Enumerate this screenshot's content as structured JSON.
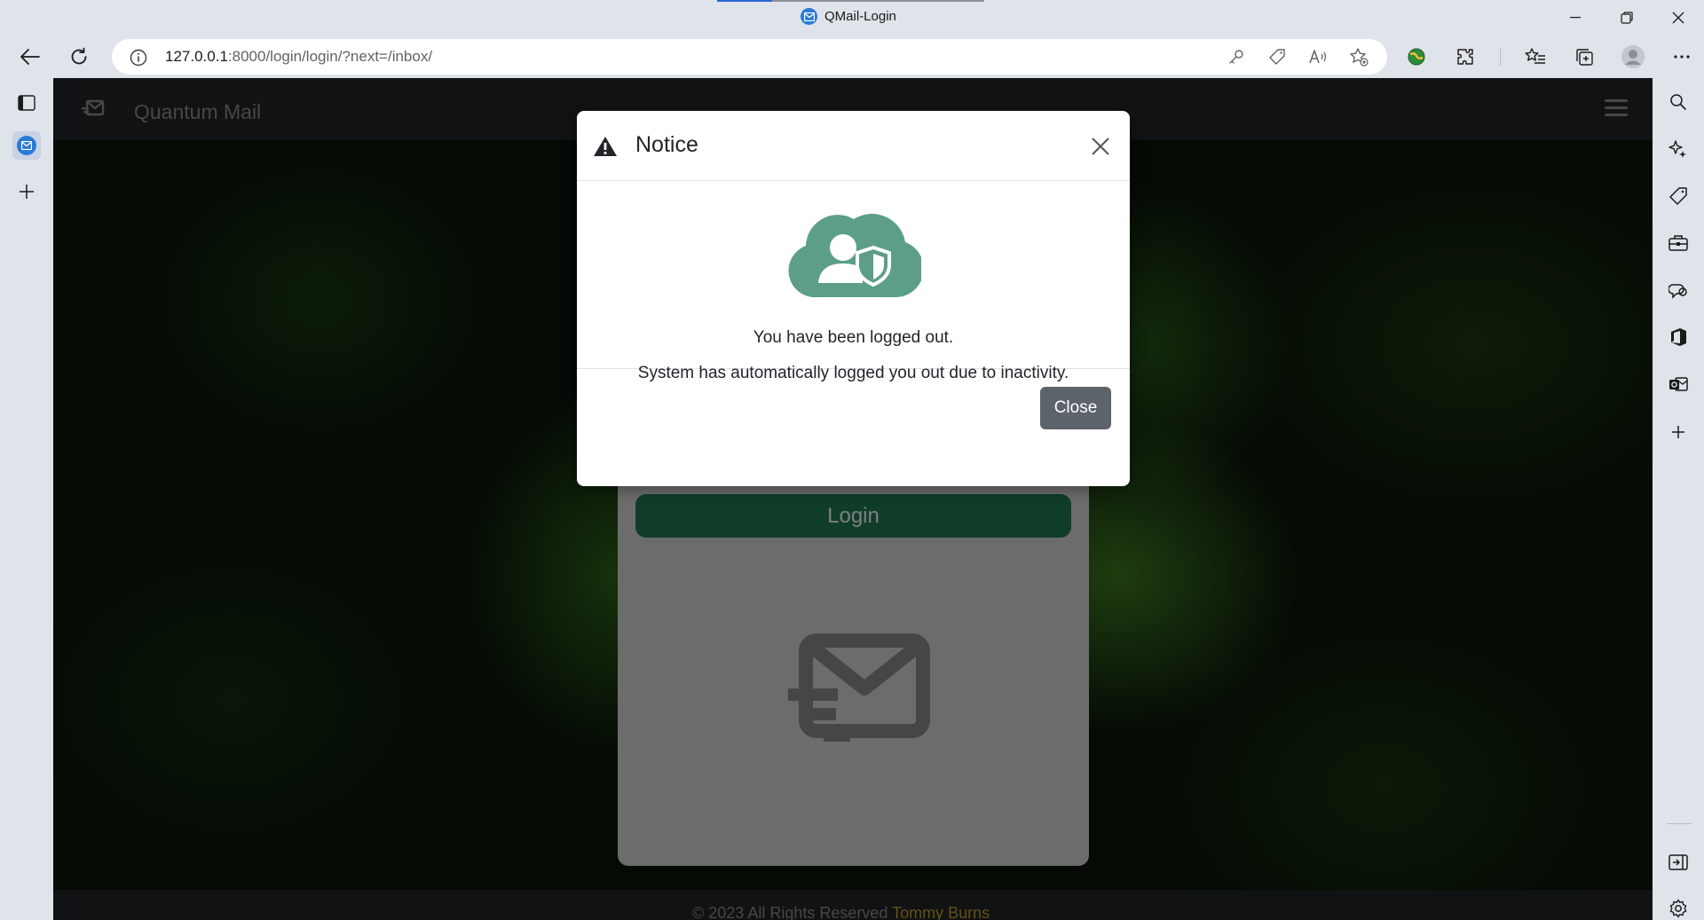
{
  "window": {
    "tab_title": "QMail-Login",
    "controls": {
      "minimize": "minimize",
      "restore": "restore",
      "close": "close"
    }
  },
  "browser": {
    "url_host": "127.0.0.1",
    "url_rest": ":8000/login/login/?next=/inbox/",
    "icons": [
      "back-icon",
      "refresh-icon",
      "info-icon",
      "key-icon",
      "tag-icon",
      "read-aloud-icon",
      "favorite-add-icon",
      "extension-globe-icon",
      "extensions-icon",
      "favorites-icon",
      "collections-icon",
      "profile-avatar",
      "more-icon"
    ]
  },
  "left_tabs": {
    "icons": [
      "tab-actions-icon",
      "qmail-tab-icon",
      "new-tab-icon"
    ]
  },
  "right_sidebar": {
    "icons": [
      "search-icon",
      "copilot-icon",
      "shopping-icon",
      "tools-icon",
      "games-icon",
      "office-icon",
      "outlook-icon",
      "add-icon",
      "hide-sidebar-icon",
      "settings-icon"
    ]
  },
  "app": {
    "brand": "Quantum Mail",
    "login_button": "Login",
    "footer_prefix": "© 2023 All Rights Reserved ",
    "footer_author": "Tommy Burns",
    "colors": {
      "navbar": "#212529",
      "login_button": "#1f7a50",
      "author": "#c9a227"
    }
  },
  "modal": {
    "title": "Notice",
    "message_primary": "You have been logged out.",
    "message_secondary": "System has automatically logged you out due to inactivity.",
    "close_button": "Close",
    "colors": {
      "icon": "#5c9e88",
      "close_button": "#5c636a"
    }
  }
}
